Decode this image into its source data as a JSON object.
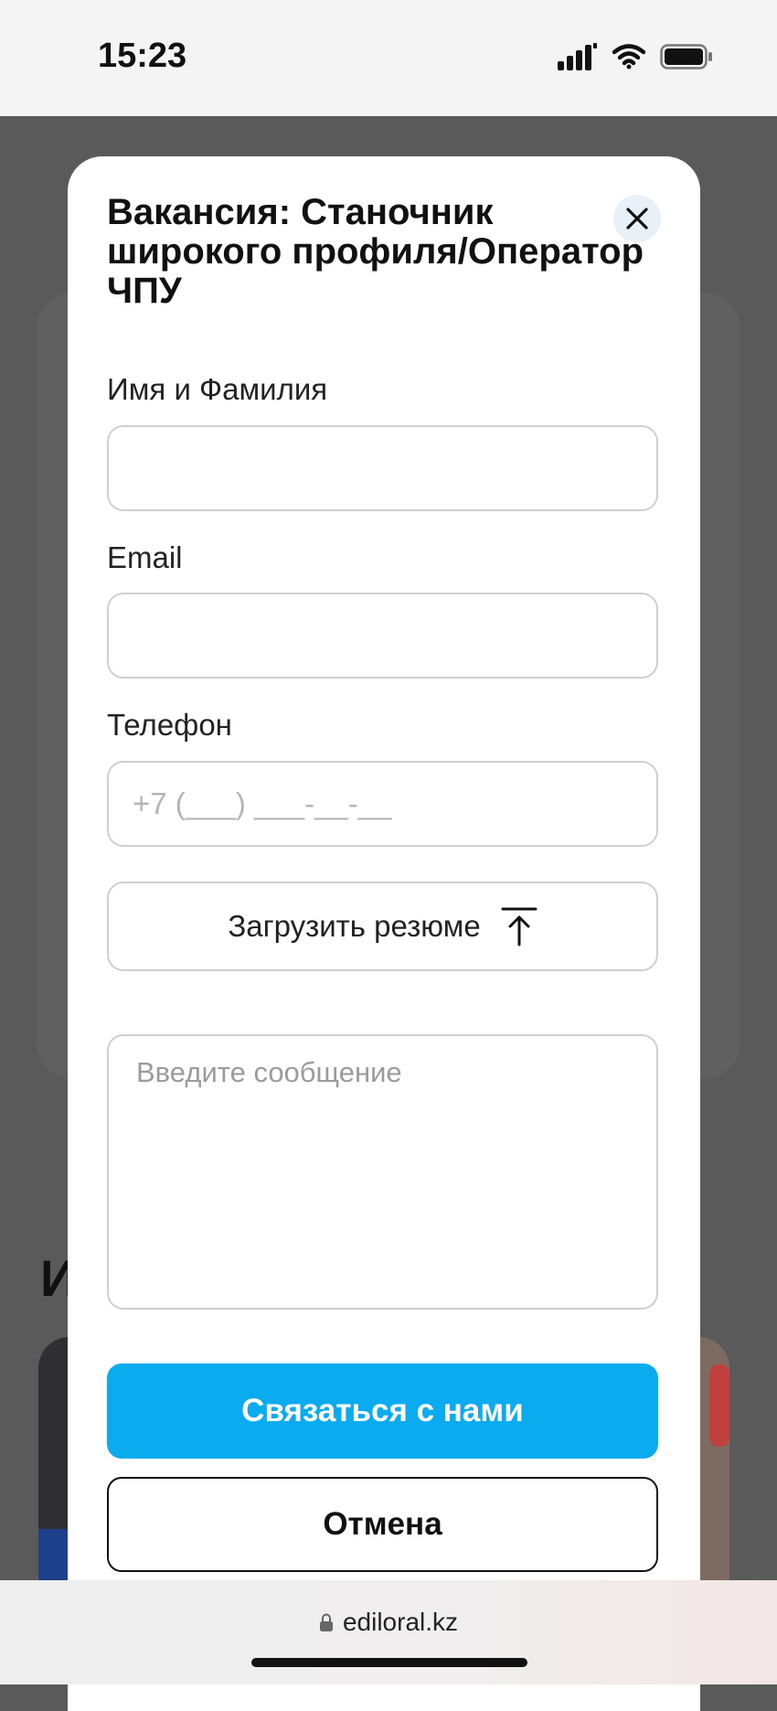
{
  "status_bar": {
    "time": "15:23"
  },
  "background": {
    "heading_fragment": "И"
  },
  "modal": {
    "title": "Вакансия: Станочник широкого профиля/Оператор ЧПУ",
    "fields": {
      "name_label": "Имя и Фамилия",
      "name_value": "",
      "email_label": "Email",
      "email_value": "",
      "phone_label": "Телефон",
      "phone_placeholder": "+7 (___) ___-__-__"
    },
    "upload_label": "Загрузить резюме",
    "message_placeholder": "Введите сообщение",
    "submit_label": "Связаться с нами",
    "cancel_label": "Отмена"
  },
  "browser": {
    "url": "ediloral.kz"
  },
  "colors": {
    "accent": "#0aabef",
    "overlay": "#5a5a5a"
  },
  "icons": [
    "signal-icon",
    "wifi-icon",
    "battery-icon",
    "close-icon",
    "upload-icon",
    "lock-icon"
  ]
}
